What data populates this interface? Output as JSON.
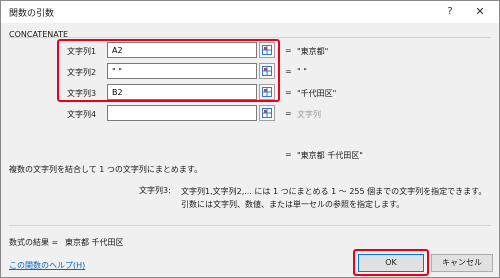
{
  "dialog": {
    "title": "関数の引数",
    "help_button": "?",
    "close_button": "✕"
  },
  "function_name": "CONCATENATE",
  "args": [
    {
      "label": "文字列1",
      "value": "A2",
      "result": "\"東京都\""
    },
    {
      "label": "文字列2",
      "value": "\" \"",
      "result": "\" \""
    },
    {
      "label": "文字列3",
      "value": "B2",
      "result": "\"千代田区\""
    },
    {
      "label": "文字列4",
      "value": "",
      "result": "文字列"
    }
  ],
  "equals": "=",
  "overall_result": "\"東京都 千代田区\"",
  "description": "複数の文字列を結合して 1 つの文字列にまとめます。",
  "arg_help_label": "文字列3:",
  "arg_help_text": "文字列1,文字列2,... には 1 つにまとめる 1 ～ 255 個までの文字列を指定できます。引数には文字列、数値、または単一セルの参照を指定します。",
  "formula_result_label": "数式の結果 =",
  "formula_result_value": "東京都 千代田区",
  "help_link": "この関数のヘルプ(H)",
  "ok_label": "OK",
  "cancel_label": "キャンセル",
  "colors": {
    "highlight": "#e8001c",
    "link": "#0066cc"
  },
  "icons": {
    "ref": "range-select-icon"
  }
}
